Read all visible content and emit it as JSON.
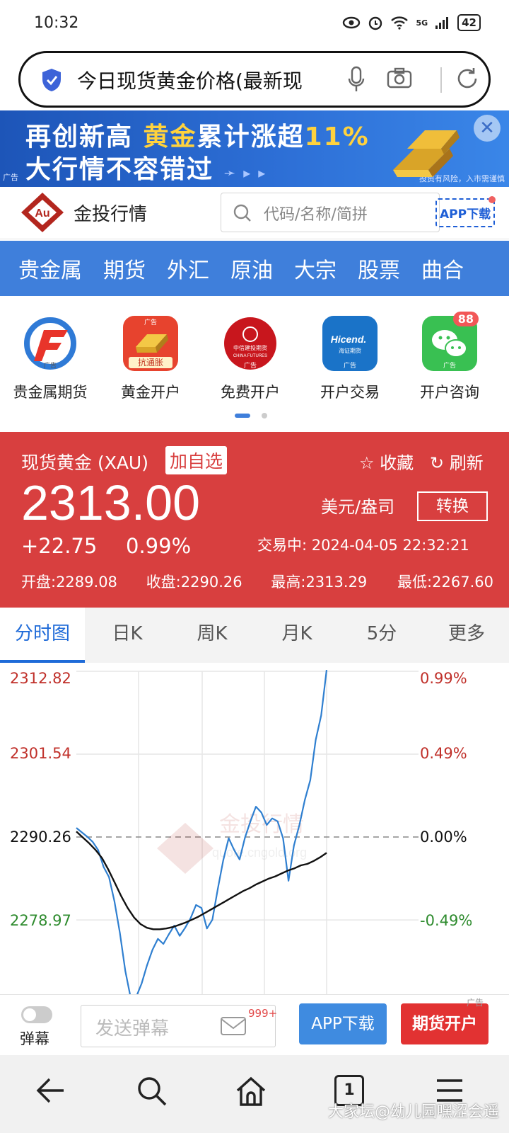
{
  "status_bar": {
    "time": "10:32",
    "battery": "42",
    "network": "5G"
  },
  "url_bar": {
    "query": "今日现货黄金价格(最新现"
  },
  "ad_banner": {
    "line1_a": "再创新高 ",
    "line1_gold": "黄金",
    "line1_b": "累计涨超",
    "line1_pct": "11%",
    "line2": "大行情不容错过",
    "ad_tag": "广告",
    "risk_text": "投资有风险，入市需谨慎"
  },
  "site_header": {
    "logo_text": "Au",
    "site_name": "金投行情",
    "search_placeholder": "代码/名称/简拼",
    "app_download": "APP下载"
  },
  "nav": {
    "items": [
      "贵金属",
      "期货",
      "外汇",
      "原油",
      "大宗",
      "股票",
      "曲合"
    ]
  },
  "apps": [
    {
      "label": "贵金属期货",
      "ad": "广告"
    },
    {
      "label": "黄金开户",
      "ad": "广告",
      "sub": "抗通胀"
    },
    {
      "label": "免费开户",
      "ad": "广告",
      "sub": "中信建投期货"
    },
    {
      "label": "开户交易",
      "ad": "广告",
      "sub": "Hicend."
    },
    {
      "label": "开户咨询",
      "ad": "广告",
      "badge": "88"
    }
  ],
  "quote": {
    "name": "现货黄金 (XAU)",
    "add_watch": "加自选",
    "favorite": "收藏",
    "refresh": "刷新",
    "price": "2313.00",
    "change": "+22.75",
    "change_pct": "0.99%",
    "unit": "美元/盎司",
    "convert": "转换",
    "status": "交易中: 2024-04-05 22:32:21",
    "open": "开盘:2289.08",
    "close": "收盘:2290.26",
    "high": "最高:2313.29",
    "low": "最低:2267.60"
  },
  "chart_tabs": [
    "分时图",
    "日K",
    "周K",
    "月K",
    "5分",
    "更多"
  ],
  "chart_data": {
    "type": "line",
    "prev_close": 2290.26,
    "y_left_labels": [
      "2312.82",
      "2301.54",
      "2290.26",
      "2278.97"
    ],
    "y_right_labels": [
      "0.99%",
      "0.49%",
      "0.00%",
      "-0.49%"
    ],
    "ylim": [
      2267.6,
      2313.3
    ],
    "series": [
      {
        "color": "#2f7fd0",
        "values": [
          2291.5,
          2290.9,
          2290.3,
          2289.6,
          2288.5,
          2286.2,
          2284.8,
          2281.5,
          2277.2,
          2272.0,
          2268.3,
          2268.5,
          2270.3,
          2272.8,
          2274.9,
          2276.4,
          2275.7,
          2277.0,
          2278.2,
          2276.8,
          2277.9,
          2279.2,
          2281.0,
          2280.6,
          2277.8,
          2279.0,
          2283.2,
          2287.1,
          2290.1,
          2288.5,
          2287.2,
          2290.2,
          2292.4,
          2294.4,
          2293.6,
          2291.9,
          2292.8,
          2292.4,
          2290.1,
          2284.3,
          2289.1,
          2291.9,
          2295.3,
          2298.0,
          2303.5,
          2306.8,
          2313.0
        ]
      },
      {
        "color": "#111111",
        "values": [
          2291.0,
          2290.2,
          2289.4,
          2288.5,
          2287.4,
          2285.8,
          2284.0,
          2282.2,
          2280.6,
          2279.3,
          2278.4,
          2277.9,
          2277.7,
          2277.7,
          2277.8,
          2278.0,
          2278.3,
          2278.6,
          2279.0,
          2279.4,
          2279.9,
          2280.4,
          2280.9,
          2281.4,
          2281.9,
          2282.4,
          2282.9,
          2283.3,
          2283.8,
          2284.2,
          2284.6,
          2284.9,
          2285.3,
          2285.7,
          2286.0,
          2286.4,
          2286.6,
          2287.0,
          2287.5,
          2288.1
        ]
      }
    ]
  },
  "watermark_text": "金投行情",
  "watermark_url": "quote.cngold.org",
  "bottom_bar": {
    "danmu": "弹幕",
    "send_placeholder": "发送弹幕",
    "msg_count": "999+",
    "app_download": "APP下载",
    "futures_open": "期货开户",
    "ad": "广告"
  },
  "nav_bar": {
    "tabs_count": "1",
    "watermark": "大家坛@幼儿园嘿涩会遥"
  }
}
